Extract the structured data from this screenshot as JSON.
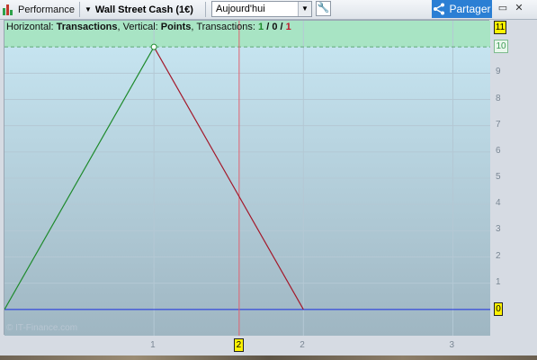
{
  "toolbar": {
    "performance_label": "Performance",
    "instrument_label": "Wall Street Cash (1€)",
    "period_value": "Aujourd'hui",
    "share_label": "Partager"
  },
  "chart_info": {
    "horizontal_prefix": "Horizontal: ",
    "horizontal_value": "Transactions",
    "vertical_prefix": ", Vertical: ",
    "vertical_value": "Points",
    "transactions_prefix": ", Transactions: ",
    "tx_win": "1",
    "tx_sep1": " / ",
    "tx_neutral": "0",
    "tx_sep2": " / ",
    "tx_loss": "1"
  },
  "watermark": "© IT-Finance.com",
  "colors": {
    "profit_zone": "#a8e4c4",
    "gain_line": "#1e8a2c",
    "loss_line": "#a3182a",
    "zero_line": "#1a2ee0",
    "cursor_line": "#e06070",
    "share_button": "#2b7fd4"
  },
  "icons": {
    "performance": "candlestick-chart-icon",
    "instrument_dropdown": "caret-down-icon",
    "period_dropdown": "chevron-down-icon",
    "settings": "wrench-icon",
    "share": "share-icon",
    "maximize": "maximize-icon",
    "close": "close-icon"
  },
  "chart_data": {
    "type": "line",
    "title": "",
    "xlabel": "Transactions",
    "ylabel": "Points",
    "x": [
      0,
      1,
      2
    ],
    "series": [
      {
        "values": [
          0,
          10,
          0
        ]
      }
    ],
    "segments": [
      {
        "from": [
          0,
          0
        ],
        "to": [
          1,
          10
        ],
        "result": "gain"
      },
      {
        "from": [
          1,
          10
        ],
        "to": [
          2,
          0
        ],
        "result": "loss"
      }
    ],
    "xlim": [
      0,
      3.25
    ],
    "ylim": [
      -1,
      11
    ],
    "x_ticks": [
      "1",
      "2",
      "3"
    ],
    "y_ticks": [
      "1",
      "2",
      "3",
      "4",
      "5",
      "6",
      "7",
      "8",
      "9"
    ],
    "labels": {
      "max": "11",
      "peak": "10",
      "zero": "0",
      "cursor": "2"
    },
    "cursor_x": 1.57,
    "zero_line": 0,
    "grid": true
  }
}
